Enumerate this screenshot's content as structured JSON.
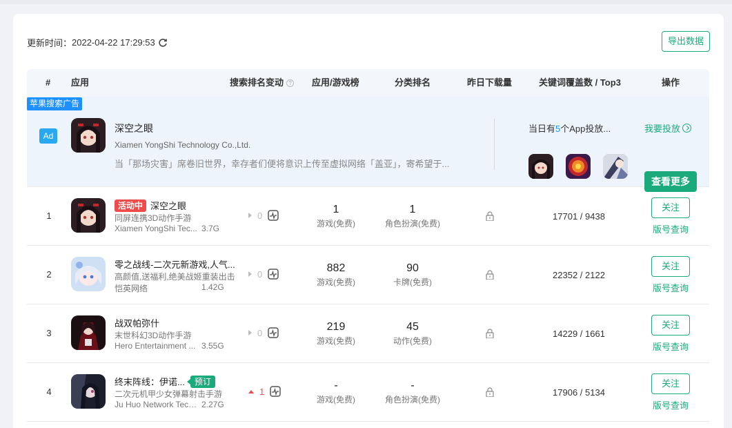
{
  "header": {
    "update_label": "更新时间：",
    "update_time": "2022-04-22 17:29:53",
    "export_label": "导出数据"
  },
  "columns": [
    "#",
    "应用",
    "搜索排名变动",
    "应用/游戏榜",
    "分类排名",
    "昨日下载量",
    "关键词覆盖数 / Top3",
    "操作"
  ],
  "ad": {
    "tag": "苹果搜索广告",
    "badge": "Ad",
    "name": "深空之眼",
    "company": "Xiamen YongShi Technology Co.,Ltd.",
    "desc": "当「那场灾害」席卷旧世界，幸存者们便将意识上传至虚拟网络「盖亚」，寄希望于...",
    "today_prefix": "当日有",
    "today_count": "5",
    "today_suffix": "个App投放...",
    "place_label": "我要投放",
    "more_label": "查看更多"
  },
  "rows": [
    {
      "rank": "1",
      "badge": "活动中",
      "name": "深空之眼",
      "subtitle": "同屏连携3D动作手游",
      "company": "Xiamen YongShi Tec...",
      "size": "3.7G",
      "change": "0",
      "change_dir": "none",
      "chart_rank": "1",
      "chart_label": "游戏(免费)",
      "cat_rank": "1",
      "cat_label": "角色扮演(免费)",
      "keywords": "17701 / 9438",
      "follow": "关注",
      "version": "版号查询"
    },
    {
      "rank": "2",
      "name": "零之战线-二次元新游戏,人气...",
      "subtitle": "高颜值,送福利,绝美战姬重装出击",
      "company": "恺英网络",
      "size": "1.42G",
      "change": "0",
      "change_dir": "none",
      "chart_rank": "882",
      "chart_label": "游戏(免费)",
      "cat_rank": "90",
      "cat_label": "卡牌(免费)",
      "keywords": "22352 / 2122",
      "follow": "关注",
      "version": "版号查询"
    },
    {
      "rank": "3",
      "name": "战双帕弥什",
      "subtitle": "末世科幻3D动作手游",
      "company": "Hero Entertainment ...",
      "size": "3.55G",
      "change": "0",
      "change_dir": "none",
      "chart_rank": "219",
      "chart_label": "游戏(免费)",
      "cat_rank": "45",
      "cat_label": "动作(免费)",
      "keywords": "14229 / 1661",
      "follow": "关注",
      "version": "版号查询"
    },
    {
      "rank": "4",
      "name": "终末阵线：伊诺...",
      "badge2": "预订",
      "subtitle": "二次元机甲少女弹幕射击手游",
      "company": "Ju Huo Network Tech...",
      "size": "2.27G",
      "change": "1",
      "change_dir": "up",
      "chart_rank": "-",
      "chart_label": "游戏(免费)",
      "cat_rank": "-",
      "cat_label": "角色扮演(免费)",
      "keywords": "17906 / 5134",
      "follow": "关注",
      "version": "版号查询"
    }
  ]
}
